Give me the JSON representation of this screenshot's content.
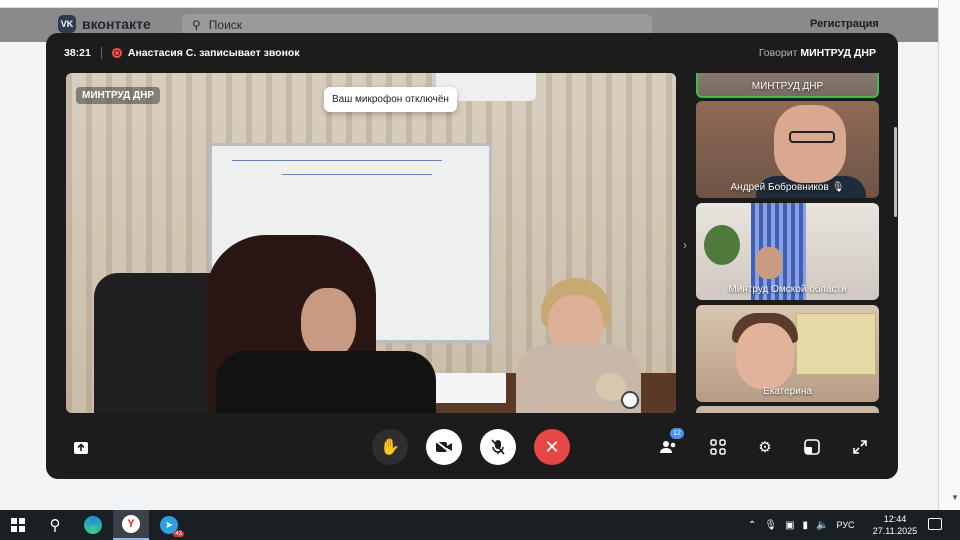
{
  "vk": {
    "logo_text": "вконтакте",
    "logo_mark": "VK",
    "search_placeholder": "Поиск",
    "register_label": "Регистрация"
  },
  "call": {
    "timer": "38:21",
    "recording_text": "Анастасия С. записывает звонок",
    "speaking_prefix": "Говорит",
    "speaking_name": "МИНТРУД ДНР",
    "main_video": {
      "name": "МИНТРУД ДНР",
      "tooltip": "Ваш микрофон отключён"
    },
    "tiles": [
      {
        "name": "МИНТРУД ДНР",
        "active": true
      },
      {
        "name": "Андрей Бобровников",
        "muted": true
      },
      {
        "name": "Минтруд Омской области"
      },
      {
        "name": "Екатерина"
      }
    ],
    "controls": {
      "participants_count": "12",
      "icons": [
        "share-screen-icon",
        "raise-hand-icon",
        "camera-off-icon",
        "mic-off-icon",
        "end-call-icon",
        "participants-icon",
        "grid-view-icon",
        "settings-icon",
        "pip-icon",
        "fullscreen-icon"
      ]
    }
  },
  "taskbar": {
    "tray_lang": "РУС",
    "time": "12:44",
    "date": "27.11.2025",
    "telegram_badge": "43"
  },
  "colors": {
    "call_bg": "#1c1c1d",
    "end_call": "#e64646",
    "active_tile_border": "#3dbd4a",
    "badge": "#4a8ef0",
    "recording": "#ff4d4d"
  }
}
